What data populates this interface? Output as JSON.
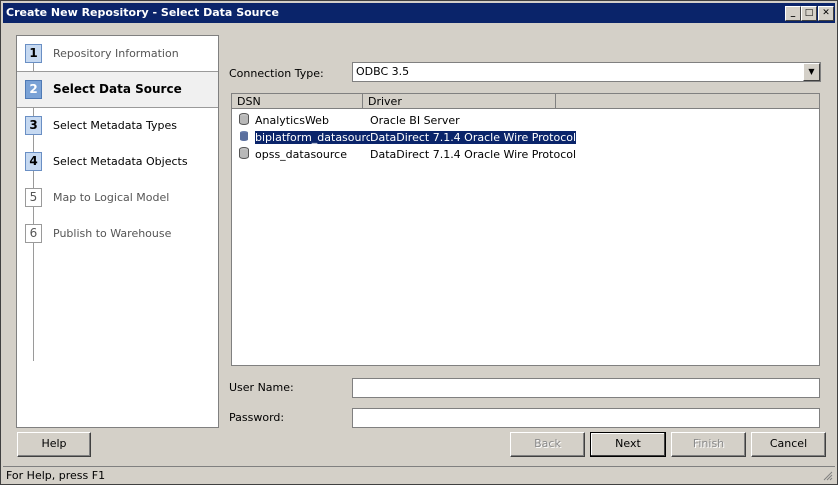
{
  "window": {
    "title": "Create New Repository - Select Data Source"
  },
  "titlebar_buttons": {
    "minimize": "_",
    "maximize": "□",
    "close": "✕"
  },
  "steps": [
    {
      "num": "1",
      "label": "Repository Information"
    },
    {
      "num": "2",
      "label": "Select Data Source"
    },
    {
      "num": "3",
      "label": "Select Metadata Types"
    },
    {
      "num": "4",
      "label": "Select Metadata Objects"
    },
    {
      "num": "5",
      "label": "Map to Logical Model"
    },
    {
      "num": "6",
      "label": "Publish to Warehouse"
    }
  ],
  "connection_type": {
    "label": "Connection Type:",
    "value": "ODBC 3.5"
  },
  "dsn_table": {
    "columns": [
      "DSN",
      "Driver"
    ],
    "rows": [
      {
        "dsn": "AnalyticsWeb",
        "driver": "Oracle BI Server"
      },
      {
        "dsn": "biplatform_datasource",
        "driver": "DataDirect 7.1.4 Oracle Wire Protocol"
      },
      {
        "dsn": "opss_datasource",
        "driver": "DataDirect 7.1.4 Oracle Wire Protocol"
      }
    ]
  },
  "user_name": {
    "label": "User Name:",
    "value": ""
  },
  "password": {
    "label": "Password:",
    "value": ""
  },
  "buttons": {
    "help": "Help",
    "back": "Back",
    "next": "Next",
    "finish": "Finish",
    "cancel": "Cancel"
  },
  "status": "For Help, press F1",
  "colors": {
    "titlebar": "#0a246a",
    "selection": "#0a246a",
    "step_active": "#7aa2d6"
  }
}
